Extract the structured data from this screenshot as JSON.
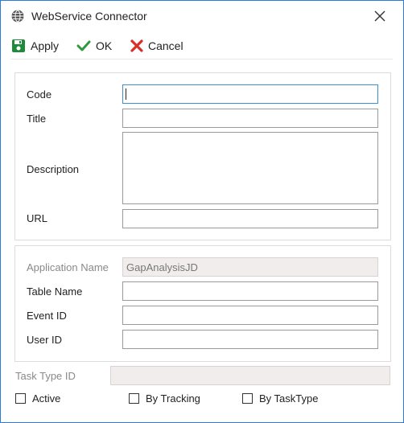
{
  "window": {
    "title": "WebService Connector"
  },
  "toolbar": {
    "apply_label": "Apply",
    "ok_label": "OK",
    "cancel_label": "Cancel"
  },
  "general": {
    "code_label": "Code",
    "code_value": "",
    "title_label": "Title",
    "title_value": "",
    "description_label": "Description",
    "description_value": "",
    "url_label": "URL",
    "url_value": ""
  },
  "mapping": {
    "application_name_label": "Application Name",
    "application_name_value": "GapAnalysisJD",
    "table_name_label": "Table Name",
    "table_name_value": "",
    "event_id_label": "Event ID",
    "event_id_value": "",
    "user_id_label": "User ID",
    "user_id_value": ""
  },
  "task": {
    "task_type_id_label": "Task Type ID",
    "task_type_id_value": ""
  },
  "options": {
    "active_label": "Active",
    "by_tracking_label": "By Tracking",
    "by_tasktype_label": "By TaskType"
  },
  "colors": {
    "border_accent": "#2b7bd8",
    "apply_icon": "#1e8a3a",
    "ok_icon": "#2e9a3e",
    "cancel_icon": "#d93025"
  }
}
